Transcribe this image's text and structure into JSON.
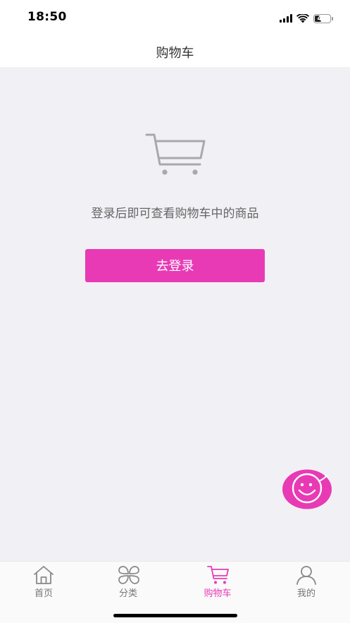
{
  "status_bar": {
    "time": "18:50",
    "battery": "44",
    "icons": [
      "signal-icon",
      "wifi-icon",
      "battery-icon"
    ]
  },
  "header": {
    "title": "购物车"
  },
  "empty_state": {
    "icon": "cart-icon",
    "message": "登录后即可查看购物车中的商品",
    "login_button_label": "去登录"
  },
  "chat_button": {
    "icon": "smiley-chat-icon"
  },
  "tab_bar": {
    "active_color": "#e93ab6",
    "inactive_color": "#777777",
    "items": [
      {
        "label": "首页",
        "icon": "home-icon",
        "active": false
      },
      {
        "label": "分类",
        "icon": "category-icon",
        "active": false
      },
      {
        "label": "购物车",
        "icon": "cart-icon",
        "active": true
      },
      {
        "label": "我的",
        "icon": "user-icon",
        "active": false
      }
    ]
  },
  "colors": {
    "accent": "#e93ab6",
    "background": "#f0f0f5"
  }
}
